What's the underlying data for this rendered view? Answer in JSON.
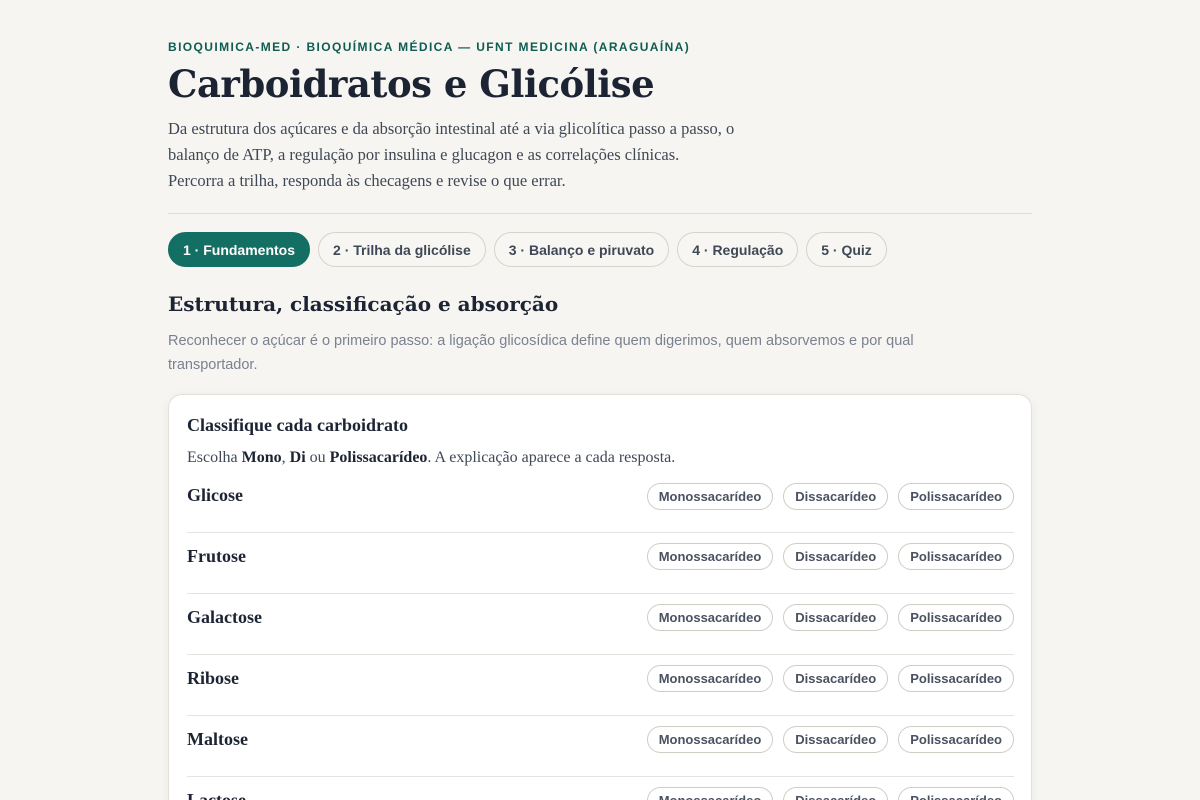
{
  "header": {
    "eyebrow": "BIOQUIMICA-MED · BIOQUÍMICA MÉDICA — UFNT MEDICINA (ARAGUAÍNA)",
    "title": "Carboidratos e Glicólise",
    "lead": "Da estrutura dos açúcares e da absorção intestinal até a via glicolítica passo a passo, o balanço de ATP, a regulação por insulina e glucagon e as correlações clínicas. Percorra a trilha, responda às checagens e revise o que errar."
  },
  "tabs": [
    {
      "label": "1 · Fundamentos",
      "active": true
    },
    {
      "label": "2 · Trilha da glicólise",
      "active": false
    },
    {
      "label": "3 · Balanço e piruvato",
      "active": false
    },
    {
      "label": "4 · Regulação",
      "active": false
    },
    {
      "label": "5 · Quiz",
      "active": false
    }
  ],
  "section": {
    "title": "Estrutura, classificação e absorção",
    "subtitle": "Reconhecer o açúcar é o primeiro passo: a ligação glicosídica define quem digerimos, quem absorvemos e por qual transportador."
  },
  "card": {
    "title": "Classifique cada carboidrato",
    "instruction_prefix": "Escolha ",
    "opt_mono": "Mono",
    "sep1": ", ",
    "opt_di": "Di",
    "sep2": " ou ",
    "opt_poli": "Polissacarídeo",
    "instruction_suffix": ". A explicação aparece a cada resposta.",
    "options": [
      "Monossacarídeo",
      "Dissacarídeo",
      "Polissacarídeo"
    ],
    "items": [
      "Glicose",
      "Frutose",
      "Galactose",
      "Ribose",
      "Maltose",
      "Lactose"
    ]
  },
  "colors": {
    "accent": "#136f63",
    "eyebrow": "#0f5c52",
    "background": "#f6f5f1"
  }
}
